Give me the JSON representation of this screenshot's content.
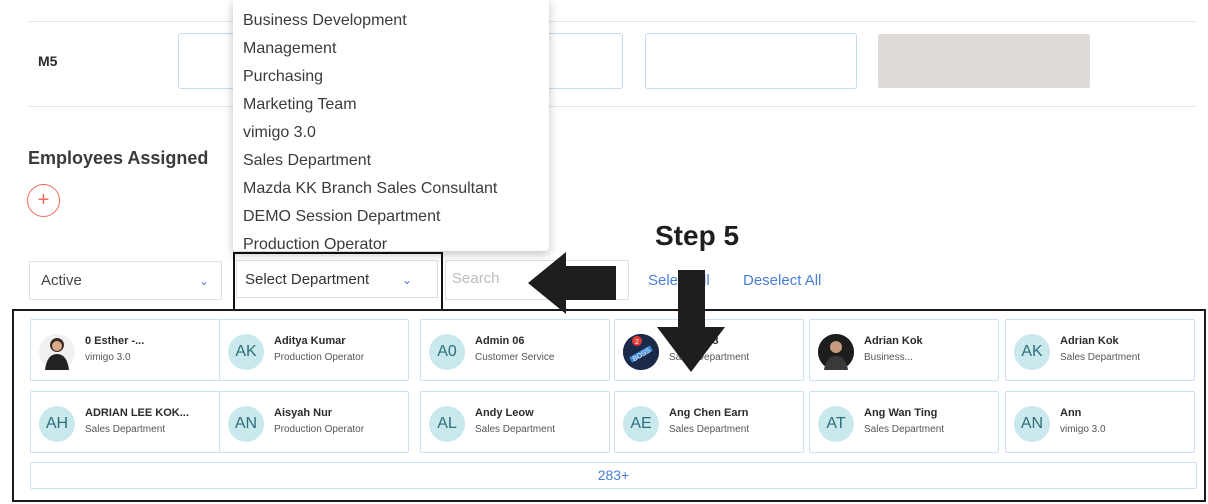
{
  "row": {
    "label": "M5"
  },
  "section": {
    "title": "Employees Assigned",
    "add_icon": "+"
  },
  "filters": {
    "status_value": "Active",
    "department_value": "Select Department",
    "search_placeholder": "Search",
    "select_all": "Select All",
    "deselect_all": "Deselect All",
    "chevron": "⌄"
  },
  "annotation": {
    "step": "Step 5"
  },
  "department_options": [
    "Business Development",
    "Management",
    "Purchasing",
    "Marketing Team",
    "vimigo 3.0",
    "Sales Department",
    "Mazda KK Branch Sales Consultant",
    "DEMO Session Department",
    "Production Operator"
  ],
  "employees": [
    {
      "initials": "",
      "name": "0 Esther -...",
      "dept": "vimigo 3.0",
      "avatar": "photo-woman"
    },
    {
      "initials": "AK",
      "name": "Aditya Kumar",
      "dept": "Production Operator"
    },
    {
      "initials": "A0",
      "name": "Admin 06",
      "dept": "Customer Service"
    },
    {
      "initials": "",
      "name": "Admin 08",
      "dept": "Sales Department",
      "avatar": "boss-badge",
      "badge_count": "2"
    },
    {
      "initials": "",
      "name": "Adrian Kok",
      "dept": "Business...",
      "avatar": "photo-man"
    },
    {
      "initials": "AK",
      "name": "Adrian Kok",
      "dept": "Sales Department"
    },
    {
      "initials": "AH",
      "name": "ADRIAN LEE KOK...",
      "dept": "Sales Department"
    },
    {
      "initials": "AN",
      "name": "Aisyah Nur",
      "dept": "Production Operator"
    },
    {
      "initials": "AL",
      "name": "Andy Leow",
      "dept": "Sales Department"
    },
    {
      "initials": "AE",
      "name": "Ang Chen Earn",
      "dept": "Sales Department"
    },
    {
      "initials": "AT",
      "name": "Ang Wan Ting",
      "dept": "Sales Department"
    },
    {
      "initials": "AN",
      "name": "Ann",
      "dept": "vimigo 3.0"
    }
  ],
  "more": {
    "label": "283+"
  },
  "colors": {
    "accent": "#4a7fd6",
    "avatar_bg": "#c9e9ec",
    "add_button": "#ef6b5c",
    "annotation": "#1e1e1e"
  }
}
